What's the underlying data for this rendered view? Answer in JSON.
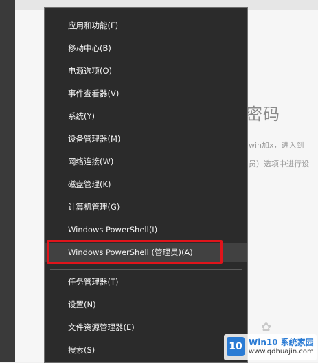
{
  "background": {
    "title": "密码",
    "line1": "win加x，进入到",
    "line2": "员）选项中进行设"
  },
  "menu": {
    "items": [
      {
        "label": "应用和功能(F)"
      },
      {
        "label": "移动中心(B)"
      },
      {
        "label": "电源选项(O)"
      },
      {
        "label": "事件查看器(V)"
      },
      {
        "label": "系统(Y)"
      },
      {
        "label": "设备管理器(M)"
      },
      {
        "label": "网络连接(W)"
      },
      {
        "label": "磁盘管理(K)"
      },
      {
        "label": "计算机管理(G)"
      },
      {
        "label": "Windows PowerShell(I)"
      },
      {
        "label": "Windows PowerShell (管理员)(A)"
      },
      {
        "label": "任务管理器(T)"
      },
      {
        "label": "设置(N)"
      },
      {
        "label": "文件资源管理器(E)"
      },
      {
        "label": "搜索(S)"
      }
    ]
  },
  "watermark": {
    "mark": "10",
    "title": "Win10 系统家园",
    "url": "www.qdhuajin.com"
  },
  "colors": {
    "menu_bg": "#2b2b2b",
    "highlight_box": "#e0141b",
    "logo_blue": "#2a7bd4"
  }
}
